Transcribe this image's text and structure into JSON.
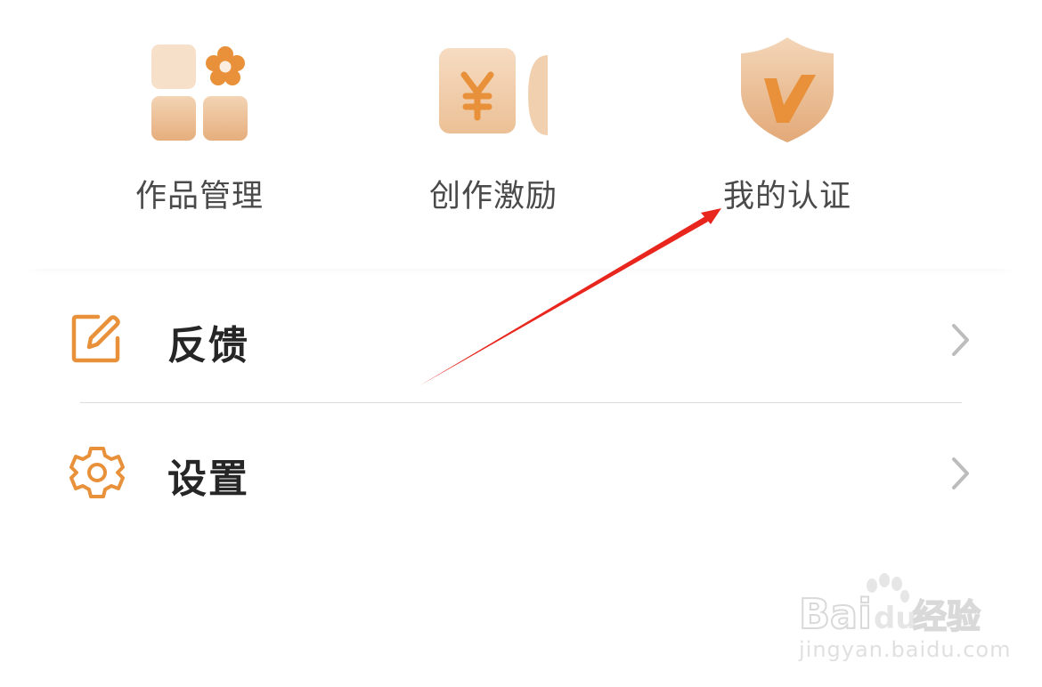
{
  "features": [
    {
      "label": "作品管理",
      "icon": "apps-grid-flower-icon"
    },
    {
      "label": "创作激励",
      "icon": "yuan-coin-icon"
    },
    {
      "label": "我的认证",
      "icon": "verified-shield-icon"
    }
  ],
  "menu": {
    "feedback": {
      "label": "反馈",
      "icon": "edit-icon"
    },
    "settings": {
      "label": "设置",
      "icon": "gear-icon"
    }
  },
  "watermark": {
    "brand": "Bai",
    "brand_suffix": "du",
    "product": "经验",
    "url": "jingyan.baidu.com"
  },
  "colors": {
    "accent": "#e8913a",
    "tile_light": "#f5dbc0",
    "tile_dark": "#e7b284",
    "annotation_arrow": "#e8261e"
  }
}
